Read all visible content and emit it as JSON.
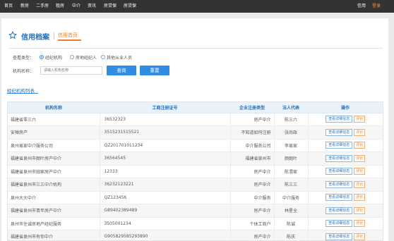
{
  "nav": {
    "items": [
      "首页",
      "新房",
      "二手房",
      "租房",
      "中介",
      "资讯",
      "房贷保",
      "房贷保"
    ],
    "credit": "信用",
    "login": "登录"
  },
  "header": {
    "title": "信用档案",
    "subtitle": "信用首页"
  },
  "filter": {
    "type_label": "查看类型：",
    "options": [
      "经纪机构",
      "房地经纪人",
      "其他从业人员"
    ],
    "selected": 0,
    "name_label": "机构名称：",
    "input_placeholder": "请输入机构名称",
    "query_button": "查询",
    "reset_button": "重置"
  },
  "list": {
    "title": "经纪机构列表",
    "columns": [
      "机构名称",
      "工商注册证号",
      "企业注册类型",
      "法人代表",
      "操作"
    ],
    "rows": [
      {
        "name": "福建省零三六",
        "license": "36532323",
        "type": "房产中介",
        "rep": "陈三六"
      },
      {
        "name": "安禅房产",
        "license": "3515231515521",
        "type": "不知道如何注册",
        "rep": "张尚政"
      },
      {
        "name": "泉州易家中介服务公司",
        "license": "QZ201701011234",
        "type": "中介服务公司",
        "rep": "李易家"
      },
      {
        "name": "福建省泉州市朗叶房产中介",
        "license": "36564545",
        "type": "福建省泉州市",
        "rep": "颜朗叶"
      },
      {
        "name": "福建省泉州市田家房产中介",
        "license": "12333",
        "type": "房产中介",
        "rep": "陈渭家"
      },
      {
        "name": "福建省泉州市三三中介机构",
        "license": "36232123221",
        "type": "房产中介",
        "rep": "陈三三"
      },
      {
        "name": "泉州大大中介",
        "license": "QZ123456",
        "type": "中介服务",
        "rep": "中介服务"
      },
      {
        "name": "福建省泉州市青年房产中介",
        "license": "G89402389489",
        "type": "房产中介",
        "rep": "林星全"
      },
      {
        "name": "泉州市住诚房地产经纪服务",
        "license": "3505001234",
        "type": "个体工商户",
        "rep": "陈诚"
      },
      {
        "name": "福建省泉州市有你中介",
        "license": "G905829585293890",
        "type": "房产中介",
        "rep": "陈庆"
      }
    ],
    "view_label": "查看详细信息",
    "rate_label": "评价"
  },
  "colors": {
    "accent": "#2f8de4",
    "orange": "#f07d2b",
    "nav_bg": "#333333"
  }
}
